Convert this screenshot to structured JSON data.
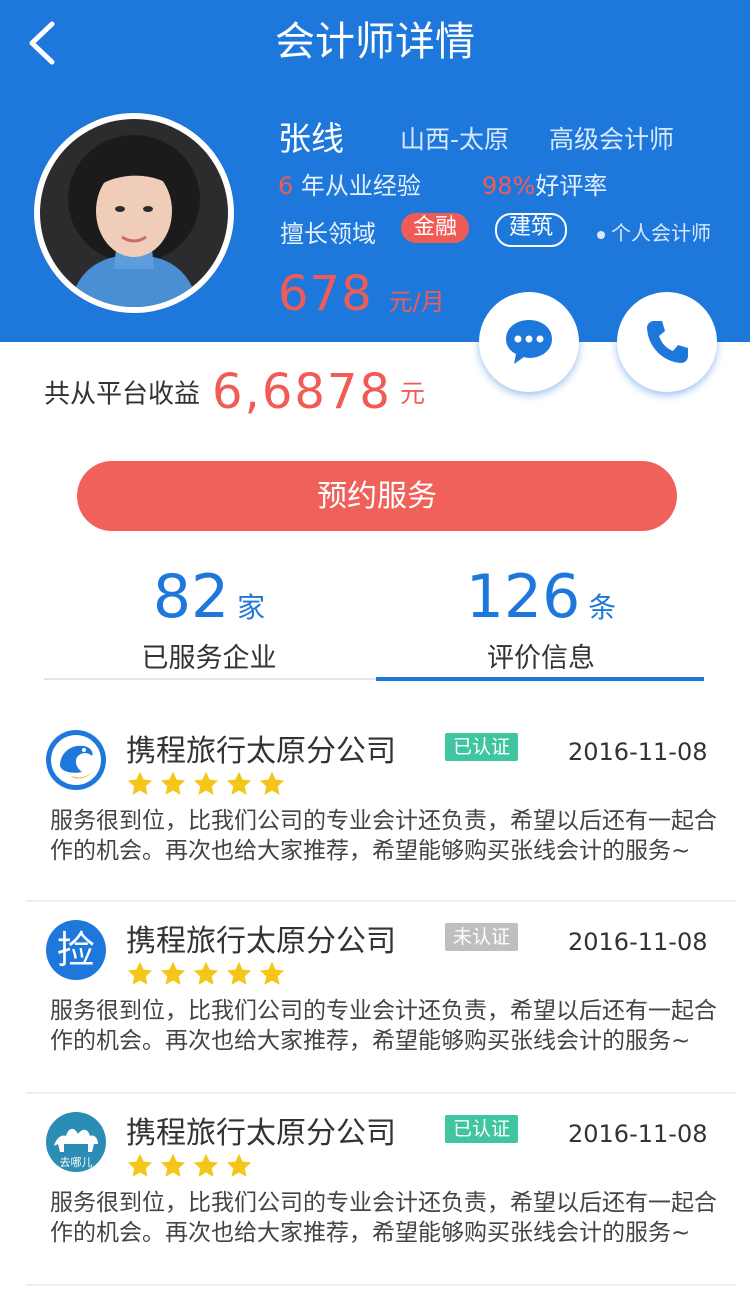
{
  "header": {
    "title": "会计师详情"
  },
  "profile": {
    "name": "张线",
    "location": "山西-太原",
    "level": "高级会计师",
    "years_num": "6",
    "years_text": " 年从业经验",
    "rate_num": "98%",
    "rate_text": "好评率",
    "fields_label": "擅长领域",
    "tags": [
      "金融",
      "建筑"
    ],
    "personal": "个人会计师",
    "price": "678",
    "price_unit": "元/月"
  },
  "income": {
    "label": "共从平台收益",
    "value": "6,6878",
    "unit": "元"
  },
  "book_button": "预约服务",
  "stats": {
    "served": {
      "num": "82",
      "unit": "家",
      "label": "已服务企业"
    },
    "reviews": {
      "num": "126",
      "unit": "条",
      "label": "评价信息"
    }
  },
  "reviews": [
    {
      "company": "携程旅行太原分公司",
      "badge": "已认证",
      "date": "2016-11-08",
      "stars": 5,
      "logo": "ctrip-dolphin-icon",
      "text": "服务很到位，比我们公司的专业会计还负责，希望以后还有一起合作的机会。再次也给大家推荐，希望能够购买张线会计的服务~"
    },
    {
      "company": "携程旅行太原分公司",
      "badge": "未认证",
      "date": "2016-11-08",
      "stars": 5,
      "logo": "jian-char-icon",
      "logo_text": "捡",
      "text": "服务很到位，比我们公司的专业会计还负责，希望以后还有一起合作的机会。再次也给大家推荐，希望能够购买张线会计的服务~"
    },
    {
      "company": "携程旅行太原分公司",
      "badge": "已认证",
      "date": "2016-11-08",
      "stars": 4,
      "logo": "qunar-camel-icon",
      "logo_text": "去哪儿",
      "text": "服务很到位，比我们公司的专业会计还负责，希望以后还有一起合作的机会。再次也给大家推荐，希望能够购买张线会计的服务~"
    }
  ],
  "colors": {
    "primary": "#1e78dc",
    "accent": "#f15b55",
    "verified": "#3fc6a0",
    "unverified": "#bfbfbf",
    "star": "#f5c518"
  }
}
